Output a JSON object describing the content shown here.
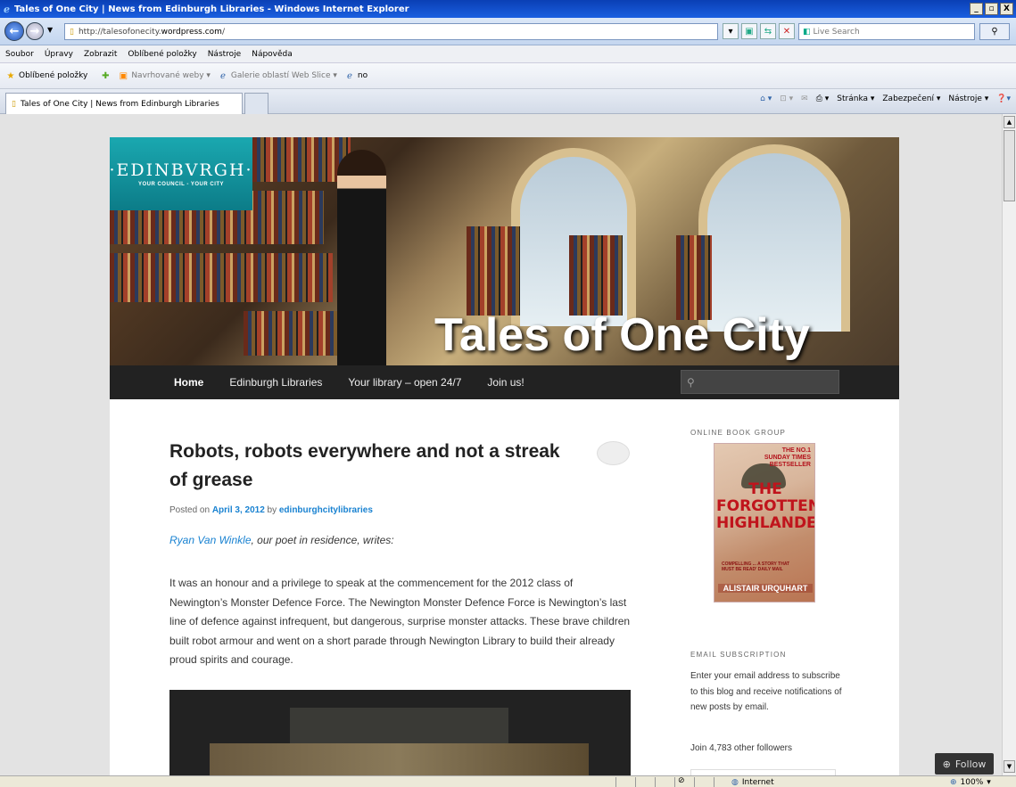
{
  "window": {
    "title": "Tales of One City | News from Edinburgh Libraries - Windows Internet Explorer",
    "min": "_",
    "max": "▫",
    "close": "X"
  },
  "address_bar": {
    "url_prefix": "http://talesofonecity.",
    "url_domain": "wordpress.com",
    "url_suffix": "/",
    "search_logo": "Live",
    "search_placeholder": "Live Search"
  },
  "menu": [
    "Soubor",
    "Úpravy",
    "Zobrazit",
    "Oblíbené položky",
    "Nástroje",
    "Nápověda"
  ],
  "favorites": {
    "label": "Oblíbené položky",
    "items": [
      "Navrhované weby ▾",
      "Galerie oblastí Web Slice ▾",
      "no"
    ]
  },
  "tabs": {
    "active": "Tales of One City | News from Edinburgh Libraries"
  },
  "command_bar": {
    "page": "Stránka ▾",
    "safety": "Zabezpečení ▾",
    "tools": "Nástroje ▾"
  },
  "status_bar": {
    "zone": "Internet",
    "zoom": "100%"
  },
  "site": {
    "logo_main": "·EDINBVRGH·",
    "logo_sub": "YOUR COUNCIL - YOUR CITY",
    "banner_title": "Tales of One City",
    "nav": [
      "Home",
      "Edinburgh Libraries",
      "Your library – open 24/7",
      "Join us!"
    ]
  },
  "post": {
    "title": "Robots, robots everywhere and not a streak of grease",
    "meta_prefix": "Posted on",
    "date": "April 3, 2012",
    "meta_by": "by",
    "author": "edinburghcitylibraries",
    "intro_link": "Ryan Van Winkle",
    "intro_rest": ", our poet in residence, writes:",
    "body": "It was an honour and a privilege to speak at the commencement for the 2012 class of  Newington’s Monster Defence Force. The Newington Monster Defence Force is Newington’s last line of defence against infrequent, but dangerous, surprise monster attacks. These brave children built robot armour and went on a short parade through Newington Library to build their already proud spirits and courage."
  },
  "sidebar": {
    "book_group_title": "ONLINE BOOK GROUP",
    "book": {
      "tag_line1": "THE NO.1",
      "tag_line2": "SUNDAY TIMES",
      "tag_line3": "BESTSELLER",
      "title": "THE FORGOTTEN HIGHLANDER",
      "quote": "COMPELLING ... A STORY THAT MUST BE READ' DAILY MAIL",
      "author": "ALISTAIR URQUHART"
    },
    "email_title": "EMAIL SUBSCRIPTION",
    "email_text": "Enter your email address to subscribe to this blog and receive notifications of new posts by email.",
    "followers": "Join 4,783 other followers"
  },
  "follow_button": "Follow"
}
